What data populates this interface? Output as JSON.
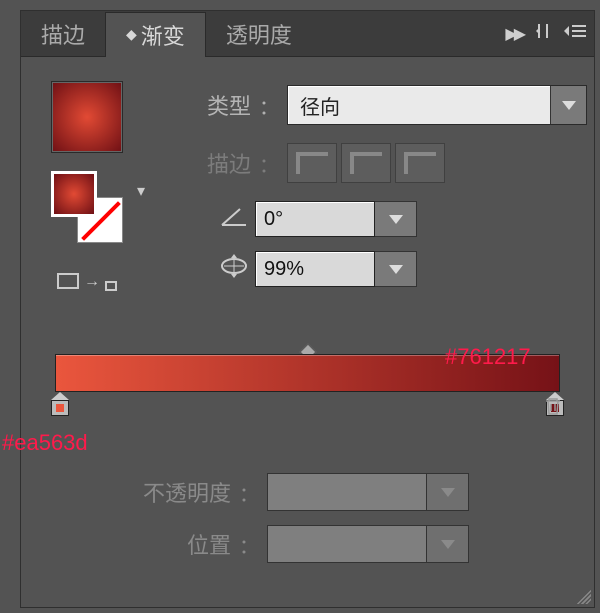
{
  "tabs": {
    "stroke": "描边",
    "gradient": "渐变",
    "transparency": "透明度"
  },
  "type": {
    "label": "类型",
    "value": "径向"
  },
  "stroke": {
    "label": "描边"
  },
  "angle": {
    "value": "0°"
  },
  "aspect": {
    "value": "99%"
  },
  "stops": {
    "left_color": "#ea563d",
    "right_color": "#761217",
    "left_label": "#ea563d",
    "right_label": "#761217"
  },
  "opacity": {
    "label": "不透明度"
  },
  "position": {
    "label": "位置"
  },
  "colon": "："
}
